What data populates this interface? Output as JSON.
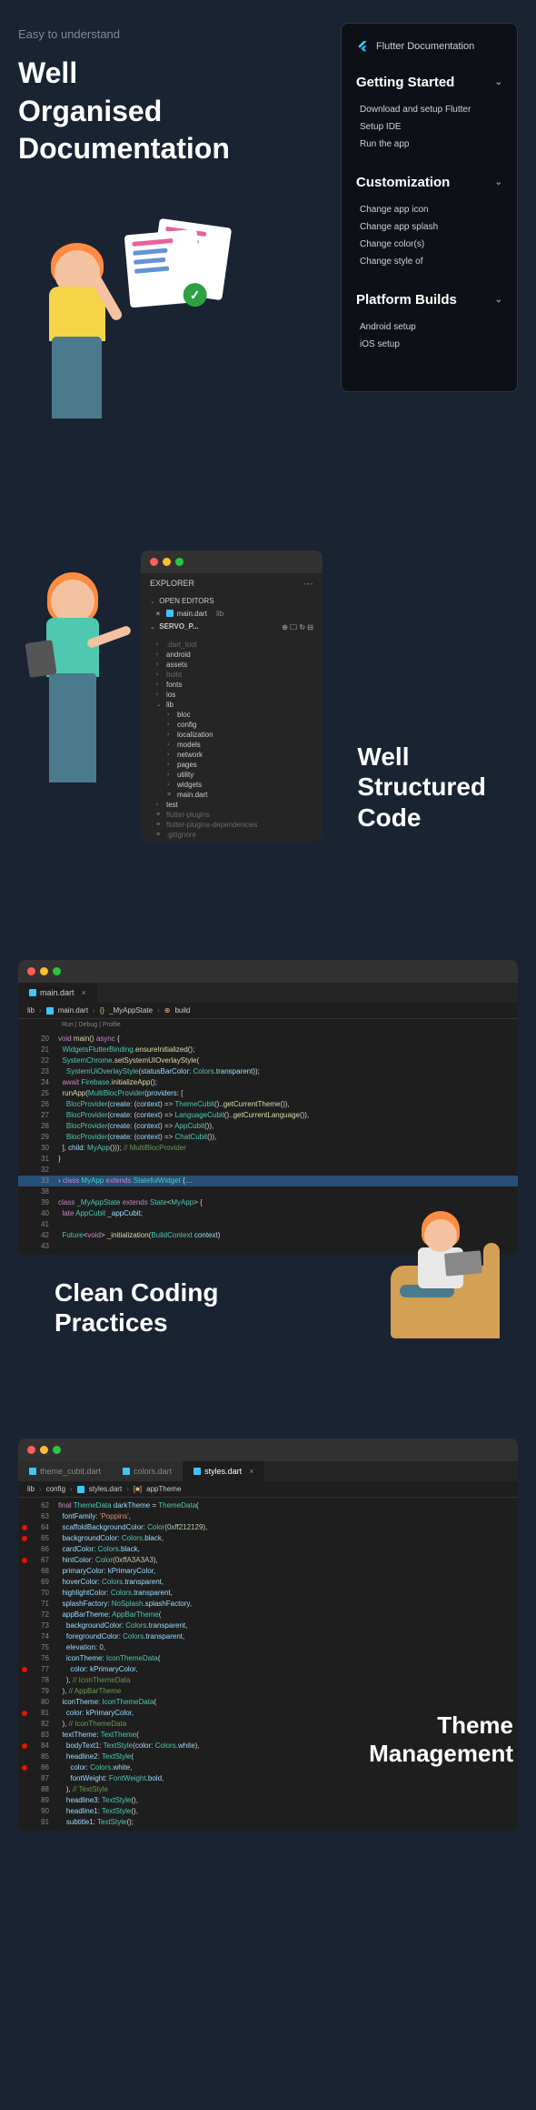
{
  "s1": {
    "subtitle": "Easy to understand",
    "heading_l1": "Well",
    "heading_l2": "Organised",
    "heading_l3": "Documentation",
    "panel": {
      "brand": "Flutter Documentation",
      "sections": [
        {
          "title": "Getting Started",
          "items": [
            "Download and setup Flutter",
            "Setup IDE",
            "Run the app"
          ]
        },
        {
          "title": "Customization",
          "items": [
            "Change app icon",
            "Change app splash",
            "Change color(s)",
            "Change style of"
          ]
        },
        {
          "title": "Platform Builds",
          "items": [
            "Android setup",
            "iOS setup"
          ]
        }
      ]
    }
  },
  "s2": {
    "heading_l1": "Well",
    "heading_l2": "Structured",
    "heading_l3": "Code",
    "explorer": {
      "title": "EXPLORER",
      "open_editors": "OPEN EDITORS",
      "tab": "main.dart",
      "tab_folder": "lib",
      "project": "SERVO_P...",
      "tree": [
        {
          "l": 0,
          "t": ".dart_tool",
          "c": "chev",
          "dim": true
        },
        {
          "l": 0,
          "t": "android",
          "c": "chev"
        },
        {
          "l": 0,
          "t": "assets",
          "c": "chev"
        },
        {
          "l": 0,
          "t": "build",
          "c": "chev",
          "dim": true
        },
        {
          "l": 0,
          "t": "fonts",
          "c": "chev"
        },
        {
          "l": 0,
          "t": "ios",
          "c": "chev"
        },
        {
          "l": 0,
          "t": "lib",
          "c": "open"
        },
        {
          "l": 1,
          "t": "bloc",
          "c": "chev"
        },
        {
          "l": 1,
          "t": "config",
          "c": "chev"
        },
        {
          "l": 1,
          "t": "localization",
          "c": "chev"
        },
        {
          "l": 1,
          "t": "models",
          "c": "chev"
        },
        {
          "l": 1,
          "t": "network",
          "c": "chev"
        },
        {
          "l": 1,
          "t": "pages",
          "c": "chev"
        },
        {
          "l": 1,
          "t": "utility",
          "c": "chev"
        },
        {
          "l": 1,
          "t": "widgets",
          "c": "chev"
        },
        {
          "l": 1,
          "t": "main.dart",
          "c": "file"
        },
        {
          "l": 0,
          "t": "test",
          "c": "chev"
        },
        {
          "l": 0,
          "t": "flutter-plugins",
          "c": "file",
          "dim": true
        },
        {
          "l": 0,
          "t": "flutter-plugins-dependencies",
          "c": "file",
          "dim": true
        },
        {
          "l": 0,
          "t": ".gitignore",
          "c": "file",
          "dim": true
        }
      ]
    }
  },
  "s3": {
    "heading_l1": "Clean Coding",
    "heading_l2": "Practices",
    "tab": "main.dart",
    "breadcrumb": [
      "lib",
      "main.dart",
      "_MyAppState",
      "build"
    ],
    "run_debug": "Run | Debug | Profile",
    "code": [
      {
        "n": "20",
        "h": "<span class='k'>void</span> <span class='fn'>main</span>() <span class='k'>async</span> {"
      },
      {
        "n": "21",
        "h": "  <span class='cl'>WidgetsFlutterBinding</span>.<span class='fn'>ensureInitialized</span>();"
      },
      {
        "n": "22",
        "h": "  <span class='cl'>SystemChrome</span>.<span class='fn'>setSystemUIOverlayStyle</span>("
      },
      {
        "n": "23",
        "h": "    <span class='cl'>SystemUiOverlayStyle</span>(<span class='p'>statusBarColor</span>: <span class='cl'>Colors</span>.<span class='p'>transparent</span>));"
      },
      {
        "n": "24",
        "h": "  <span class='k'>await</span> <span class='cl'>Firebase</span>.<span class='fn'>initializeApp</span>();"
      },
      {
        "n": "25",
        "h": "  <span class='fn'>runApp</span>(<span class='cl'>MultiBlocProvider</span>(<span class='p'>providers</span>: ["
      },
      {
        "n": "26",
        "h": "    <span class='cl'>BlocProvider</span>(<span class='p'>create</span>: (<span class='p'>context</span>) => <span class='cl'>ThemeCubit</span>()..<span class='fn'>getCurrentTheme</span>()),"
      },
      {
        "n": "27",
        "h": "    <span class='cl'>BlocProvider</span>(<span class='p'>create</span>: (<span class='p'>context</span>) => <span class='cl'>LanguageCubit</span>()..<span class='fn'>getCurrentLanguage</span>()),"
      },
      {
        "n": "28",
        "h": "    <span class='cl'>BlocProvider</span>(<span class='p'>create</span>: (<span class='p'>context</span>) => <span class='cl'>AppCubit</span>()),"
      },
      {
        "n": "29",
        "h": "    <span class='cl'>BlocProvider</span>(<span class='p'>create</span>: (<span class='p'>context</span>) => <span class='cl'>ChatCubit</span>()),"
      },
      {
        "n": "30",
        "h": "  ], <span class='p'>child</span>: <span class='cl'>MyApp</span>())); <span class='c'>// MultiBlocProvider</span>"
      },
      {
        "n": "31",
        "h": "}"
      },
      {
        "n": "32",
        "h": ""
      },
      {
        "n": "33",
        "h": "<span class='k'>class</span> <span class='cl'>MyApp</span> <span class='k'>extends</span> <span class='cl'>StatefulWidget</span> {<span class='d'>…</span>",
        "hl": true,
        "chv": true
      },
      {
        "n": "38",
        "h": ""
      },
      {
        "n": "39",
        "h": "<span class='k'>class</span> <span class='cl'>_MyAppState</span> <span class='k'>extends</span> <span class='cl'>State</span>&lt;<span class='cl'>MyApp</span>&gt; {"
      },
      {
        "n": "40",
        "h": "  <span class='k'>late</span> <span class='cl'>AppCubit</span> <span class='p'>_appCubit</span>;"
      },
      {
        "n": "41",
        "h": ""
      },
      {
        "n": "42",
        "h": "  <span class='cl'>Future</span>&lt;<span class='k'>void</span>&gt; <span class='fn'>_initialization</span>(<span class='cl'>BuildContext</span> <span class='p'>context</span>)"
      },
      {
        "n": "43",
        "h": ""
      }
    ]
  },
  "s4": {
    "heading_l1": "Theme",
    "heading_l2": "Management",
    "tabs": [
      "theme_cubit.dart",
      "colors.dart",
      "styles.dart"
    ],
    "active_tab": 2,
    "breadcrumb": [
      "lib",
      "config",
      "styles.dart",
      "appTheme"
    ],
    "code": [
      {
        "n": "62",
        "h": "<span class='k'>final</span> <span class='cl'>ThemeData</span> <span class='p'>darkTheme</span> = <span class='cl'>ThemeData</span>("
      },
      {
        "n": "63",
        "h": "  <span class='p'>fontFamily</span>: <span class='s'>'Poppins'</span>,"
      },
      {
        "n": "64",
        "h": "  <span class='p'>scaffoldBackgroundColor</span>: <span class='cl'>Color</span>(<span class='n'>0xff212129</span>),",
        "bp": true
      },
      {
        "n": "65",
        "h": "  <span class='p'>backgroundColor</span>: <span class='cl'>Colors</span>.<span class='p'>black</span>,",
        "bp": true
      },
      {
        "n": "66",
        "h": "  <span class='p'>cardColor</span>: <span class='cl'>Colors</span>.<span class='p'>black</span>,"
      },
      {
        "n": "67",
        "h": "  <span class='p'>hintColor</span>: <span class='cl'>Color</span>(<span class='n'>0xffA3A3A3</span>),",
        "bp": true
      },
      {
        "n": "68",
        "h": "  <span class='p'>primaryColor</span>: <span class='p'>kPrimaryColor</span>,"
      },
      {
        "n": "69",
        "h": "  <span class='p'>hoverColor</span>: <span class='cl'>Colors</span>.<span class='p'>transparent</span>,"
      },
      {
        "n": "70",
        "h": "  <span class='p'>highlightColor</span>: <span class='cl'>Colors</span>.<span class='p'>transparent</span>,"
      },
      {
        "n": "71",
        "h": "  <span class='p'>splashFactory</span>: <span class='cl'>NoSplash</span>.<span class='p'>splashFactory</span>,"
      },
      {
        "n": "72",
        "h": "  <span class='p'>appBarTheme</span>: <span class='cl'>AppBarTheme</span>("
      },
      {
        "n": "73",
        "h": "    <span class='p'>backgroundColor</span>: <span class='cl'>Colors</span>.<span class='p'>transparent</span>,"
      },
      {
        "n": "74",
        "h": "    <span class='p'>foregroundColor</span>: <span class='cl'>Colors</span>.<span class='p'>transparent</span>,"
      },
      {
        "n": "75",
        "h": "    <span class='p'>elevation</span>: <span class='n'>0</span>,"
      },
      {
        "n": "76",
        "h": "    <span class='p'>iconTheme</span>: <span class='cl'>IconThemeData</span>("
      },
      {
        "n": "77",
        "h": "      <span class='p'>color</span>: <span class='p'>kPrimaryColor</span>,",
        "bp": true
      },
      {
        "n": "78",
        "h": "    ), <span class='c'>// IconThemeData</span>"
      },
      {
        "n": "79",
        "h": "  ), <span class='c'>// AppBarTheme</span>"
      },
      {
        "n": "80",
        "h": "  <span class='p'>iconTheme</span>: <span class='cl'>IconThemeData</span>("
      },
      {
        "n": "81",
        "h": "    <span class='p'>color</span>: <span class='p'>kPrimaryColor</span>,",
        "bp": true
      },
      {
        "n": "82",
        "h": "  ), <span class='c'>// IconThemeData</span>"
      },
      {
        "n": "83",
        "h": "  <span class='p'>textTheme</span>: <span class='cl'>TextTheme</span>("
      },
      {
        "n": "84",
        "h": "    <span class='p'>bodyText1</span>: <span class='cl'>TextStyle</span>(<span class='p'>color</span>: <span class='cl'>Colors</span>.<span class='p'>white</span>),",
        "bp": true
      },
      {
        "n": "85",
        "h": "    <span class='p'>headline2</span>: <span class='cl'>TextStyle</span>("
      },
      {
        "n": "86",
        "h": "      <span class='p'>color</span>: <span class='cl'>Colors</span>.<span class='p'>white</span>,",
        "bp": true
      },
      {
        "n": "87",
        "h": "      <span class='p'>fontWeight</span>: <span class='cl'>FontWeight</span>.<span class='p'>bold</span>,"
      },
      {
        "n": "88",
        "h": "    ), <span class='c'>// TextStyle</span>"
      },
      {
        "n": "89",
        "h": "    <span class='p'>headline3</span>: <span class='cl'>TextStyle</span>(),"
      },
      {
        "n": "90",
        "h": "    <span class='p'>headline1</span>: <span class='cl'>TextStyle</span>(),"
      },
      {
        "n": "91",
        "h": "    <span class='p'>subtitle1</span>: <span class='cl'>TextStyle</span>();"
      }
    ]
  }
}
